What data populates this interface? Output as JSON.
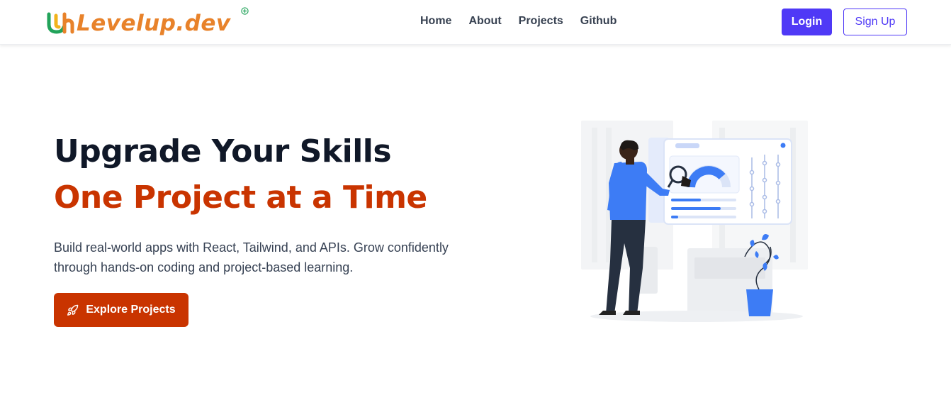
{
  "brand": {
    "name": "Levelup.dev",
    "colors": {
      "orange": "#e8822a",
      "green": "#22a35a",
      "yellow": "#f2b31b"
    }
  },
  "nav": {
    "links": [
      "Home",
      "About",
      "Projects",
      "Github"
    ],
    "login_label": "Login",
    "signup_label": "Sign Up"
  },
  "hero": {
    "title": "Upgrade Your Skills",
    "subtitle": "One Project at a Time",
    "description": "Build real-world apps with React, Tailwind, and APIs. Grow confidently through hands-on coding and project-based learning.",
    "cta_label": "Explore Projects",
    "cta_icon": "rocket-icon"
  },
  "colors": {
    "primary": "#4f39f6",
    "accent": "#c93400",
    "heading": "#101828",
    "text": "#364153",
    "illustration_blue": "#3d7cf5"
  }
}
